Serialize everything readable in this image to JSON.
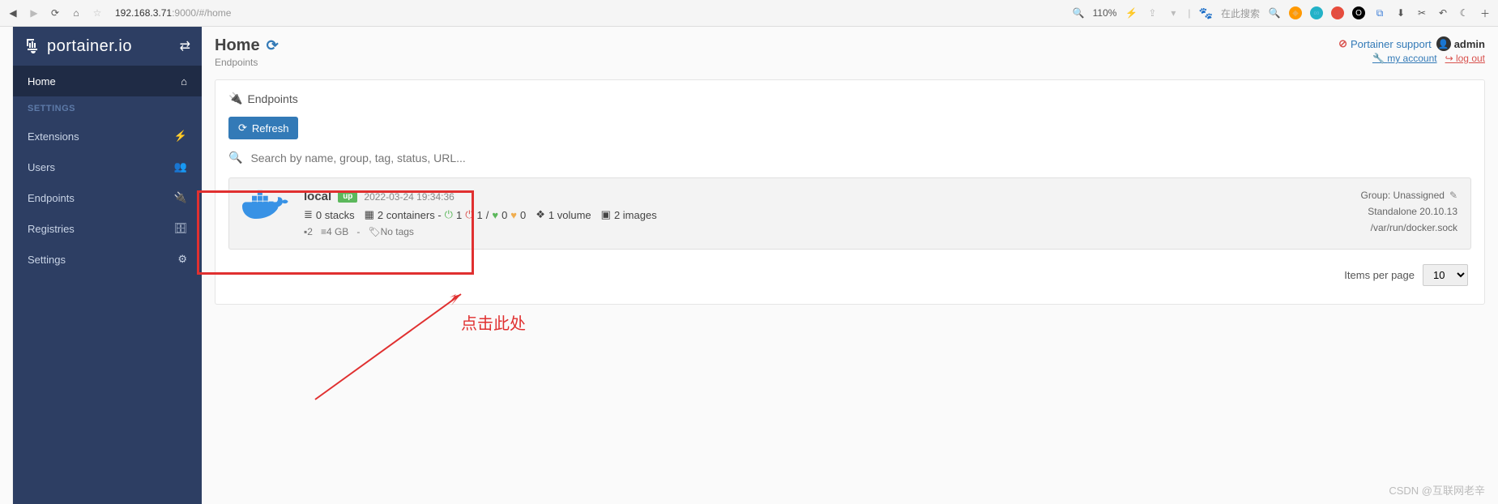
{
  "browser": {
    "url_ip": "192.168.3.71",
    "url_port": ":9000/#/home",
    "zoom": "110%",
    "search_placeholder": "在此搜索"
  },
  "sidebar": {
    "brand": "portainer.io",
    "items": [
      {
        "label": "Home",
        "icon": "home",
        "active": true
      },
      {
        "label": "SETTINGS",
        "section": true
      },
      {
        "label": "Extensions",
        "icon": "bolt"
      },
      {
        "label": "Users",
        "icon": "users"
      },
      {
        "label": "Endpoints",
        "icon": "plug"
      },
      {
        "label": "Registries",
        "icon": "db"
      },
      {
        "label": "Settings",
        "icon": "cogs"
      }
    ]
  },
  "header": {
    "title": "Home",
    "breadcrumb": "Endpoints",
    "support": "Portainer support",
    "user": "admin",
    "my_account": "my account",
    "logout": "log out"
  },
  "panel": {
    "title": "Endpoints",
    "refresh_label": "Refresh",
    "search_placeholder": "Search by name, group, tag, status, URL..."
  },
  "endpoint": {
    "name": "local",
    "status": "up",
    "timestamp": "2022-03-24 19:34:36",
    "stacks": "0 stacks",
    "containers_prefix": "2 containers -",
    "running": "1",
    "stopped": "1",
    "slash": "/",
    "healthy": "0",
    "unhealthy": "0",
    "volumes": "1 volume",
    "images": "2 images",
    "cpu": "2",
    "ram": "4 GB",
    "dash": "-",
    "tags": "No tags",
    "group": "Group: Unassigned",
    "mode": "Standalone 20.10.13",
    "socket": "/var/run/docker.sock"
  },
  "pager": {
    "label": "Items per page",
    "value": "10"
  },
  "annotation": "点击此处",
  "watermark": "CSDN @互联网老辛"
}
